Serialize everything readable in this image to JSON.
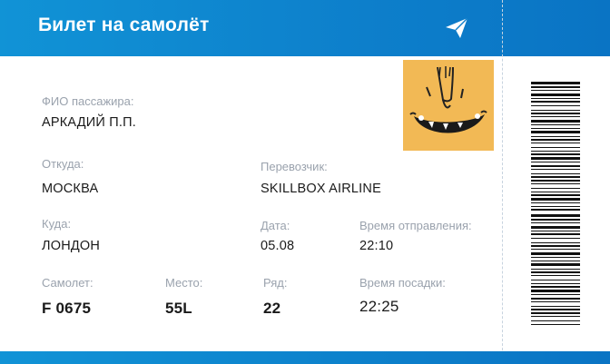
{
  "ticket": {
    "title": "Билет на самолёт",
    "plane_icon": "paper-plane-icon",
    "avatar_icon": "cartoon-face-icon",
    "barcode_icon": "barcode-icon",
    "colors": {
      "accent": "#0d7fcb",
      "avatar_bg": "#f2b955"
    }
  },
  "fields": {
    "passenger_label": "ФИО пассажира:",
    "passenger_value": "АРКАДИЙ П.П.",
    "from_label": "Откуда:",
    "from_value": "МОСКВА",
    "carrier_label": "Перевозчик:",
    "carrier_value": "SKILLBOX AIRLINE",
    "to_label": "Куда:",
    "to_value": "ЛОНДОН",
    "date_label": "Дата:",
    "date_value": "05.08",
    "departure_label": "Время отправления:",
    "departure_value": "22:10",
    "plane_label": "Самолет:",
    "plane_value": "F 0675",
    "seat_label": "Место:",
    "seat_value": "55L",
    "row_label": "Ряд:",
    "row_value": "22",
    "boarding_label": "Время посадки:",
    "boarding_value": "22:25"
  }
}
